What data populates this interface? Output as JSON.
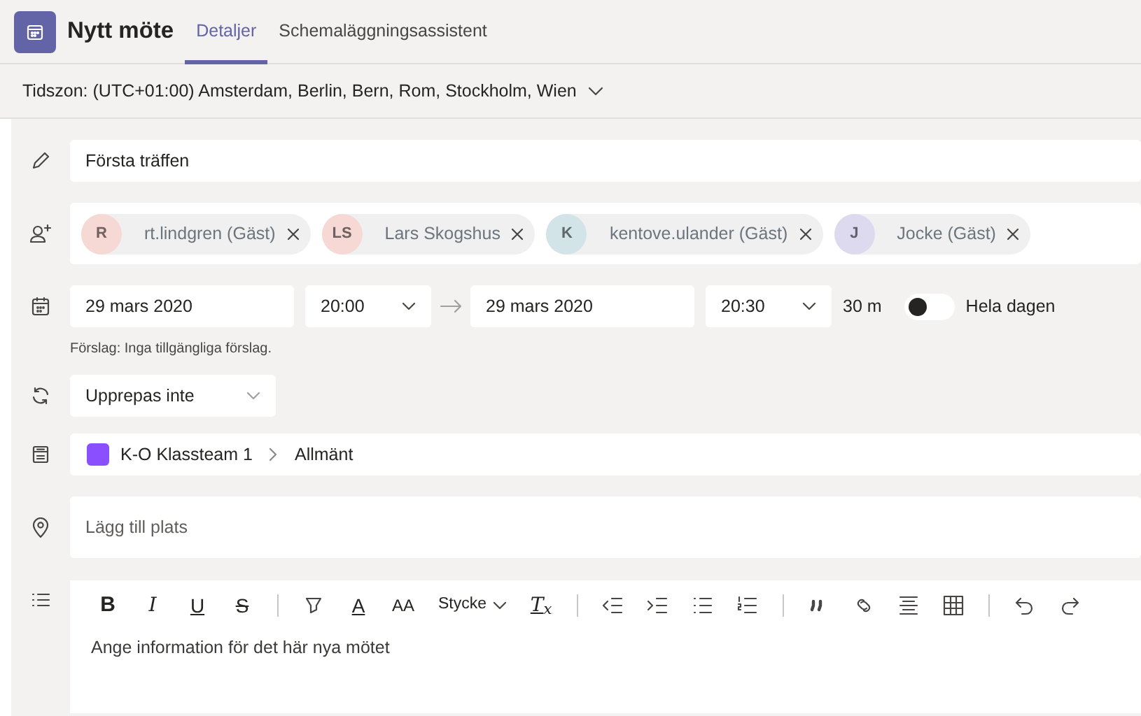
{
  "header": {
    "title": "Nytt möte",
    "tabs": [
      {
        "label": "Detaljer",
        "selected": true
      },
      {
        "label": "Schemaläggningsassistent",
        "selected": false
      }
    ]
  },
  "timezone": "Tidszon: (UTC+01:00) Amsterdam, Berlin, Bern, Rom, Stockholm, Wien",
  "title_field": {
    "value": "Första träffen"
  },
  "attendees": [
    {
      "initials": "R",
      "name": "rt.lindgren (Gäst)",
      "color": "#f6d8d4"
    },
    {
      "initials": "LS",
      "name": "Lars Skogshus",
      "color": "#f6d8d4"
    },
    {
      "initials": "K",
      "name": "kentove.ulander (Gäst)",
      "color": "#d3e4e8"
    },
    {
      "initials": "J",
      "name": "Jocke (Gäst)",
      "color": "#dddaf0"
    }
  ],
  "schedule": {
    "start_date": "29 mars 2020",
    "start_time": "20:00",
    "end_date": "29 mars 2020",
    "end_time": "20:30",
    "duration": "30 m",
    "all_day": {
      "label": "Hela dagen",
      "on": false
    },
    "suggestion": "Förslag: Inga tillgängliga förslag."
  },
  "repeat": {
    "value": "Upprepas inte"
  },
  "channel": {
    "team": "K-O Klassteam 1",
    "channel": "Allmänt"
  },
  "location": {
    "placeholder": "Lägg till plats"
  },
  "editor": {
    "toolbar": [
      {
        "kind": "bold",
        "label": "B"
      },
      {
        "kind": "italic",
        "label": "I"
      },
      {
        "kind": "underline",
        "label": "U"
      },
      {
        "kind": "strike",
        "label": "S"
      },
      {
        "kind": "sep"
      },
      {
        "kind": "highlight"
      },
      {
        "kind": "fontcolor",
        "label": "A"
      },
      {
        "kind": "fontsize",
        "label": "AA"
      },
      {
        "kind": "paragraph",
        "label": "Stycke"
      },
      {
        "kind": "clear",
        "label": "T$_{x}$"
      },
      {
        "kind": "sep"
      },
      {
        "kind": "outdent"
      },
      {
        "kind": "indent"
      },
      {
        "kind": "bullets"
      },
      {
        "kind": "numbers"
      },
      {
        "kind": "sep"
      },
      {
        "kind": "quote"
      },
      {
        "kind": "link"
      },
      {
        "kind": "align"
      },
      {
        "kind": "table"
      },
      {
        "kind": "sep"
      },
      {
        "kind": "undo"
      },
      {
        "kind": "redo"
      }
    ],
    "placeholder": "Ange information för det här nya mötet"
  }
}
